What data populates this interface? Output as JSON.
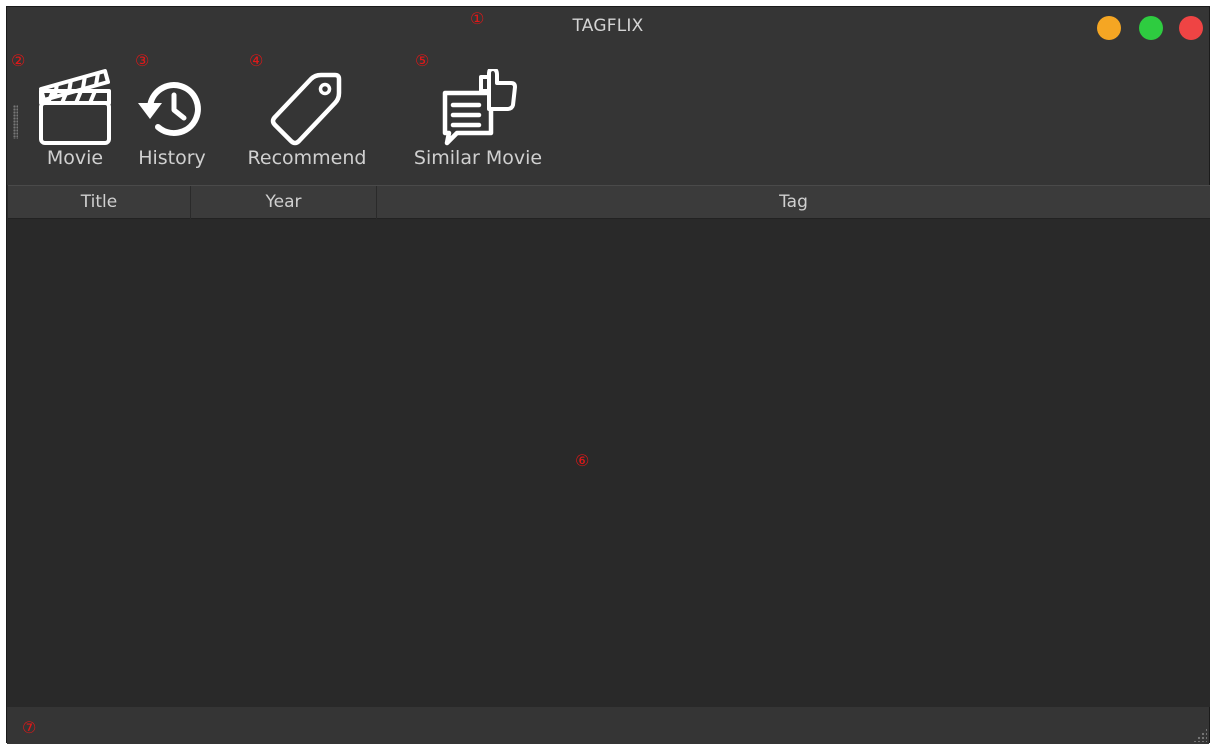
{
  "window": {
    "title": "TAGFLIX",
    "buttons": [
      {
        "name": "minimize",
        "color": "#f5a623"
      },
      {
        "name": "maximize",
        "color": "#2ecc40"
      },
      {
        "name": "close",
        "color": "#ef4444"
      }
    ]
  },
  "markers": [
    "①",
    "②",
    "③",
    "④",
    "⑤",
    "⑥",
    "⑦"
  ],
  "toolbar": {
    "movie_label": "Movie",
    "history_label": "History",
    "recommend_label": "Recommend",
    "similar_label": "Similar Movie"
  },
  "table": {
    "columns": [
      "Title",
      "Year",
      "Tag"
    ],
    "rows": []
  },
  "colors": {
    "marker": "#e01818",
    "icon": "#ffffff"
  }
}
